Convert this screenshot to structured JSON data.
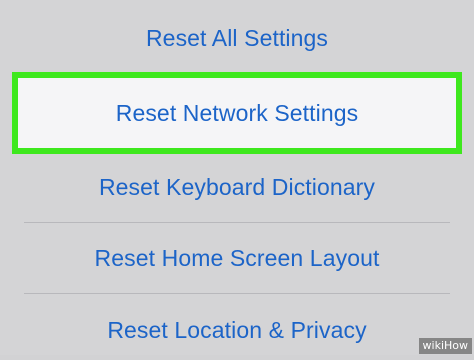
{
  "reset_menu": {
    "items": [
      {
        "label": "Reset All Settings"
      },
      {
        "label": "Reset Network Settings"
      },
      {
        "label": "Reset Keyboard Dictionary"
      },
      {
        "label": "Reset Home Screen Layout"
      },
      {
        "label": "Reset Location & Privacy"
      }
    ],
    "highlighted_index": 1
  },
  "colors": {
    "background": "#d4d4d6",
    "item_text": "#1c64c8",
    "highlight_border": "#3ee81e",
    "highlight_fill": "#f5f5f7"
  },
  "watermark": {
    "text": "wikiHow"
  }
}
